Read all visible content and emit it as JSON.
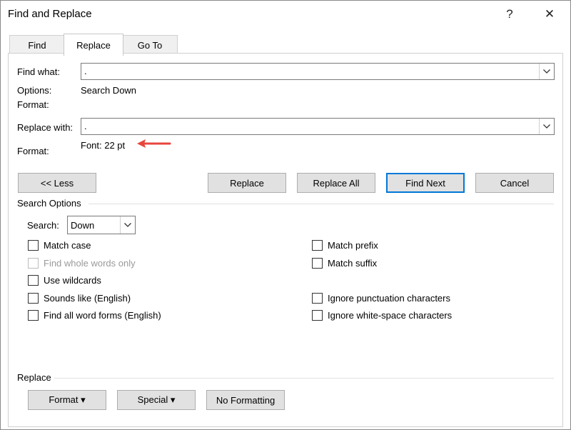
{
  "window": {
    "title": "Find and Replace",
    "help_glyph": "?",
    "close_glyph": "✕"
  },
  "tabs": [
    {
      "label": "Find",
      "active": false
    },
    {
      "label": "Replace",
      "active": true
    },
    {
      "label": "Go To",
      "active": false
    }
  ],
  "find": {
    "label": "Find what:",
    "value": ".",
    "options_label": "Options:",
    "options_value": "Search Down",
    "format_label": "Format:"
  },
  "replace": {
    "label": "Replace with:",
    "value": ".",
    "format_label": "Format:",
    "format_value": "Font: 22 pt"
  },
  "annotation": {
    "arrow_color": "#e8453c"
  },
  "buttons": {
    "less": "<< Less",
    "replace": "Replace",
    "replace_all": "Replace All",
    "find_next": "Find Next",
    "cancel": "Cancel"
  },
  "search_options": {
    "title": "Search Options",
    "search_label": "Search:",
    "search_value": "Down",
    "left": [
      {
        "label": "Match case",
        "checked": false,
        "disabled": false
      },
      {
        "label": "Find whole words only",
        "checked": false,
        "disabled": true
      },
      {
        "label": "Use wildcards",
        "checked": false,
        "disabled": false
      },
      {
        "label": "Sounds like (English)",
        "checked": false,
        "disabled": false
      },
      {
        "label": "Find all word forms (English)",
        "checked": false,
        "disabled": false
      }
    ],
    "right": [
      {
        "label": "Match prefix",
        "checked": false,
        "disabled": false
      },
      {
        "label": "Match suffix",
        "checked": false,
        "disabled": false
      },
      {
        "label": "Ignore punctuation characters",
        "checked": false,
        "disabled": false
      },
      {
        "label": "Ignore white-space characters",
        "checked": false,
        "disabled": false
      }
    ]
  },
  "replace_section": {
    "title": "Replace",
    "format_button": "Format ▾",
    "special_button": "Special ▾",
    "no_formatting_button": "No Formatting"
  },
  "colors": {
    "accent": "#0078d7",
    "annotation_red": "#e8453c"
  }
}
